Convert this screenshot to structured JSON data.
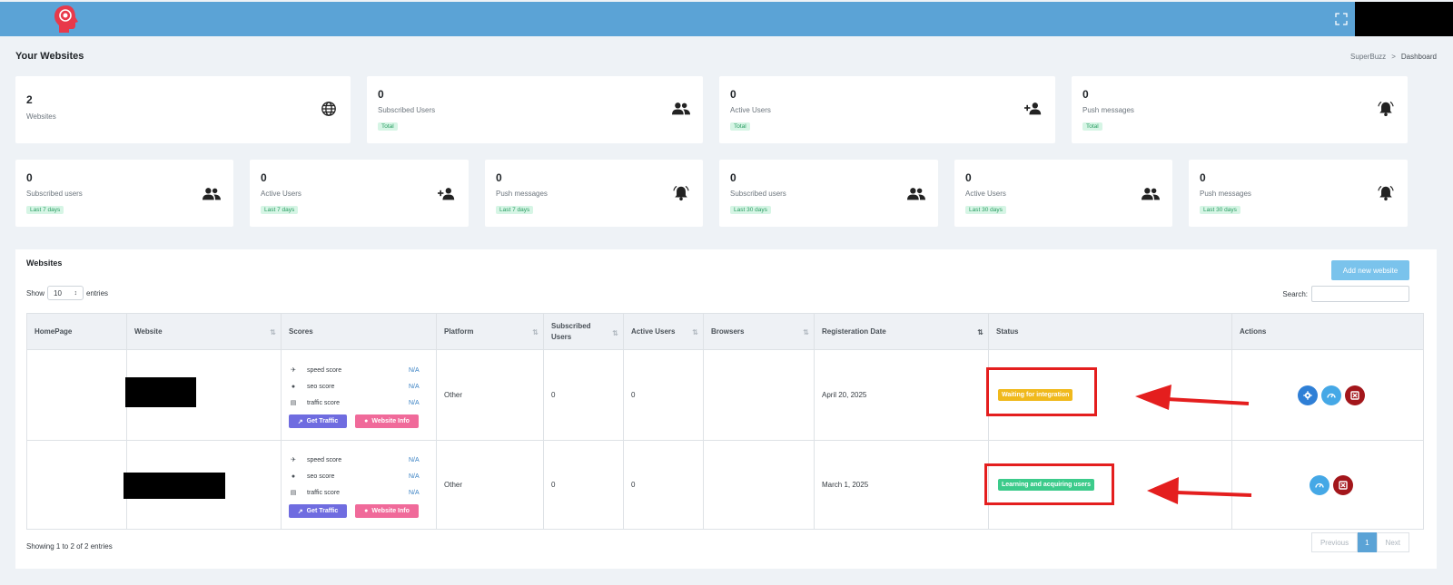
{
  "header": {
    "logo_icon": "brain-head-icon",
    "fullscreen_icon": "expand-icon"
  },
  "page": {
    "title": "Your Websites"
  },
  "breadcrumb": {
    "root": "SuperBuzz",
    "separator": ">",
    "current": "Dashboard"
  },
  "stats_top": [
    {
      "value": "2",
      "label": "Websites",
      "badge": "",
      "icon": "globe-icon"
    },
    {
      "value": "0",
      "label": "Subscribed Users",
      "badge": "Total",
      "icon": "users-icon"
    },
    {
      "value": "0",
      "label": "Active Users",
      "badge": "Total",
      "icon": "user-plus-icon"
    },
    {
      "value": "0",
      "label": "Push messages",
      "badge": "Total",
      "icon": "bell-icon"
    }
  ],
  "stats_bottom": [
    {
      "value": "0",
      "label": "Subscribed users",
      "badge": "Last 7 days",
      "icon": "users-icon"
    },
    {
      "value": "0",
      "label": "Active Users",
      "badge": "Last 7 days",
      "icon": "user-plus-icon"
    },
    {
      "value": "0",
      "label": "Push messages",
      "badge": "Last 7 days",
      "icon": "bell-icon"
    },
    {
      "value": "0",
      "label": "Subscribed users",
      "badge": "Last 30 days",
      "icon": "users-icon"
    },
    {
      "value": "0",
      "label": "Active Users",
      "badge": "Last 30 days",
      "icon": "users-icon"
    },
    {
      "value": "0",
      "label": "Push messages",
      "badge": "Last 30 days",
      "icon": "bell-icon"
    }
  ],
  "websites": {
    "title": "Websites",
    "add_button": "Add new website",
    "show_label": "Show",
    "entries_value": "10",
    "entries_label": "entries",
    "search_label": "Search:",
    "columns": [
      "HomePage",
      "Website",
      "Scores",
      "Platform",
      "Subscribed Users",
      "Active Users",
      "Browsers",
      "Registeration Date",
      "Status",
      "Actions"
    ],
    "score_names": [
      "speed score",
      "seo score",
      "traffic score"
    ],
    "get_traffic_label": "Get Traffic",
    "website_info_label": "Website Info",
    "rows": [
      {
        "scores": [
          "N/A",
          "N/A",
          "N/A"
        ],
        "platform": "Other",
        "subscribed": "0",
        "active": "0",
        "browsers": "",
        "date": "April 20, 2025",
        "status": "Waiting for integration",
        "status_color": "#f0b91c"
      },
      {
        "scores": [
          "N/A",
          "N/A",
          "N/A"
        ],
        "platform": "Other",
        "subscribed": "0",
        "active": "0",
        "browsers": "",
        "date": "March 1, 2025",
        "status": "Learning and acquiring users",
        "status_color": "#3ccb8b"
      }
    ],
    "footer": "Showing 1 to 2 of 2 entries",
    "pagination": {
      "previous": "Previous",
      "current": "1",
      "next": "Next"
    }
  },
  "colors": {
    "topbar": "#5ba3d6",
    "highlight": "#e41e1e",
    "accent": "#7ac3ec"
  }
}
